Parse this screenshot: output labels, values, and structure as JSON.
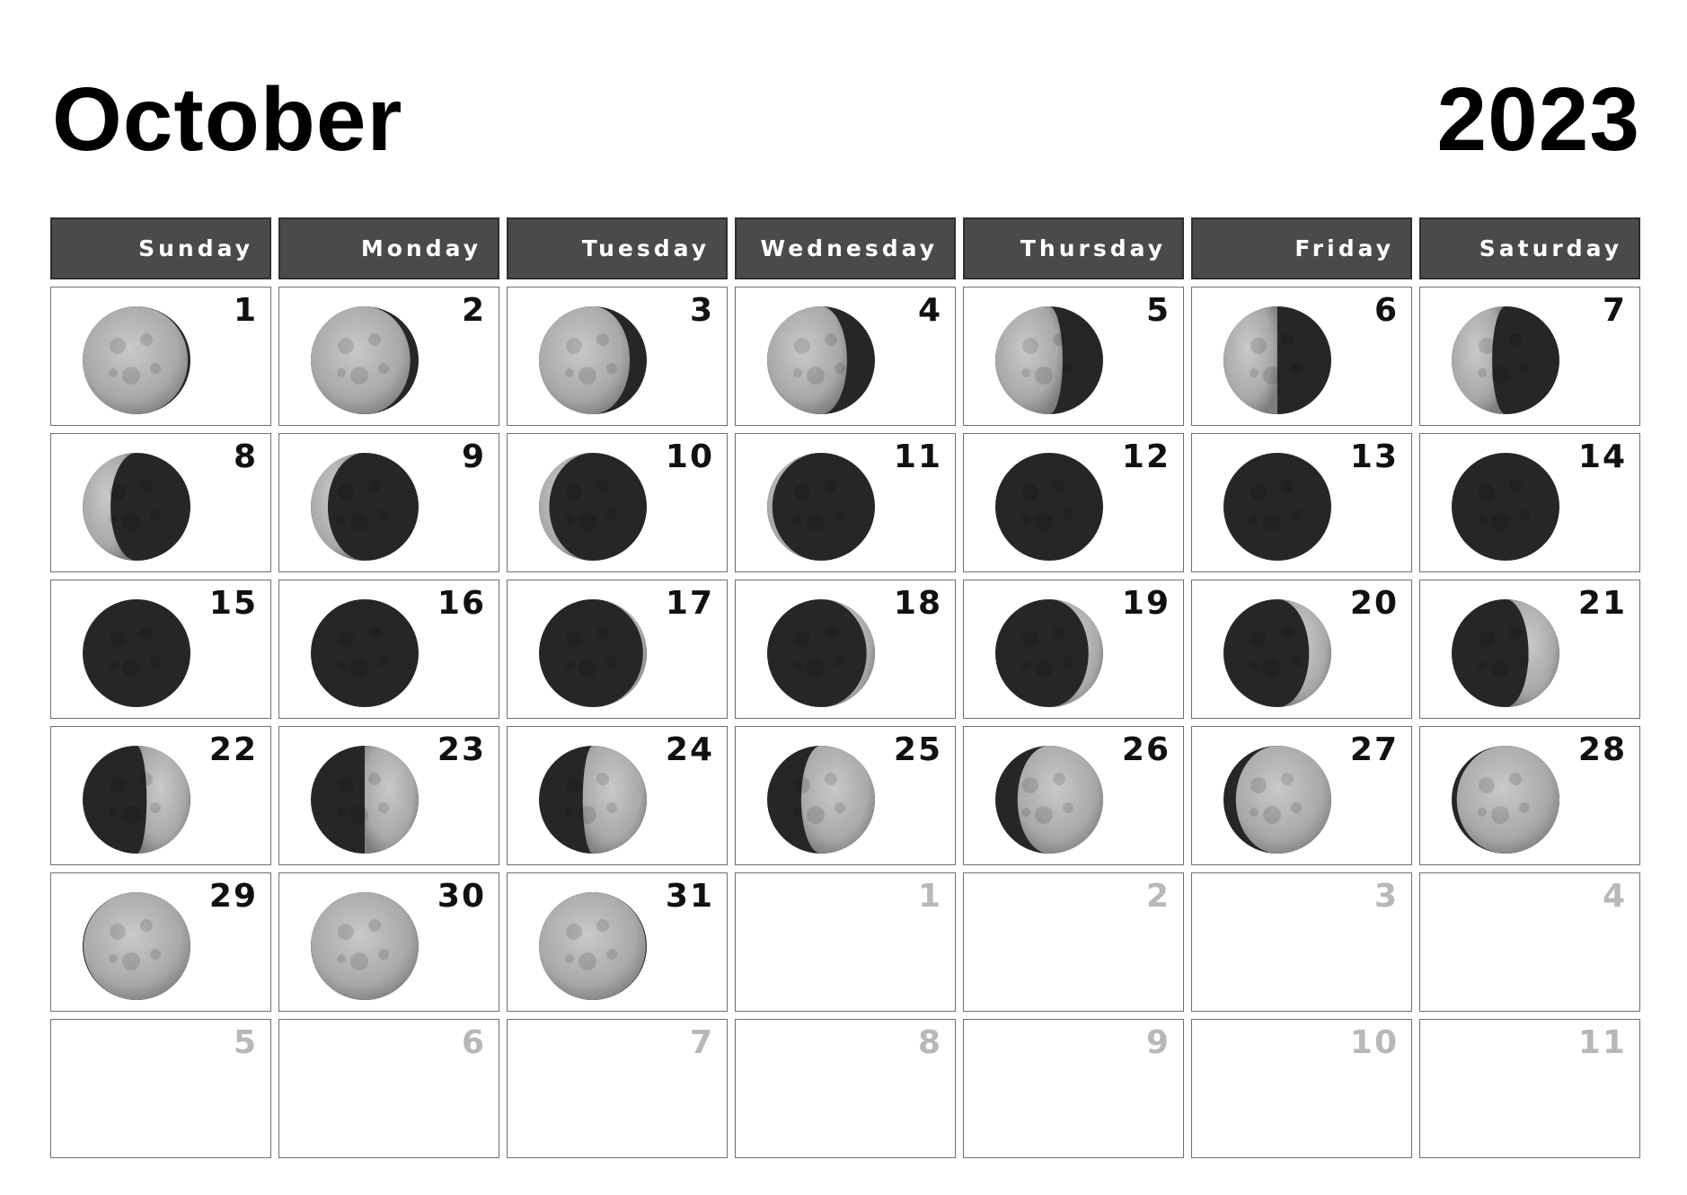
{
  "title": {
    "month": "October",
    "year": "2023"
  },
  "weekdays": [
    "Sunday",
    "Monday",
    "Tuesday",
    "Wednesday",
    "Thursday",
    "Friday",
    "Saturday"
  ],
  "days": [
    {
      "label": "1",
      "current": true,
      "phase": 0.05
    },
    {
      "label": "2",
      "current": true,
      "phase": 0.09
    },
    {
      "label": "3",
      "current": true,
      "phase": 0.13
    },
    {
      "label": "4",
      "current": true,
      "phase": 0.17
    },
    {
      "label": "5",
      "current": true,
      "phase": 0.21
    },
    {
      "label": "6",
      "current": true,
      "phase": 0.25
    },
    {
      "label": "7",
      "current": true,
      "phase": 0.29
    },
    {
      "label": "8",
      "current": true,
      "phase": 0.33
    },
    {
      "label": "9",
      "current": true,
      "phase": 0.37
    },
    {
      "label": "10",
      "current": true,
      "phase": 0.4
    },
    {
      "label": "11",
      "current": true,
      "phase": 0.43
    },
    {
      "label": "12",
      "current": true,
      "phase": 0.46
    },
    {
      "label": "13",
      "current": true,
      "phase": 0.48
    },
    {
      "label": "14",
      "current": true,
      "phase": 0.5
    },
    {
      "label": "15",
      "current": true,
      "phase": 0.51
    },
    {
      "label": "16",
      "current": true,
      "phase": 0.53
    },
    {
      "label": "17",
      "current": true,
      "phase": 0.56
    },
    {
      "label": "18",
      "current": true,
      "phase": 0.59
    },
    {
      "label": "19",
      "current": true,
      "phase": 0.62
    },
    {
      "label": "20",
      "current": true,
      "phase": 0.65
    },
    {
      "label": "21",
      "current": true,
      "phase": 0.68
    },
    {
      "label": "22",
      "current": true,
      "phase": 0.72
    },
    {
      "label": "23",
      "current": true,
      "phase": 0.75
    },
    {
      "label": "24",
      "current": true,
      "phase": 0.78
    },
    {
      "label": "25",
      "current": true,
      "phase": 0.81
    },
    {
      "label": "26",
      "current": true,
      "phase": 0.85
    },
    {
      "label": "27",
      "current": true,
      "phase": 0.89
    },
    {
      "label": "28",
      "current": true,
      "phase": 0.93
    },
    {
      "label": "29",
      "current": true,
      "phase": 0.97
    },
    {
      "label": "30",
      "current": true,
      "phase": 0.99
    },
    {
      "label": "31",
      "current": true,
      "phase": 0.03
    },
    {
      "label": "1",
      "current": false
    },
    {
      "label": "2",
      "current": false
    },
    {
      "label": "3",
      "current": false
    },
    {
      "label": "4",
      "current": false
    },
    {
      "label": "5",
      "current": false
    },
    {
      "label": "6",
      "current": false
    },
    {
      "label": "7",
      "current": false
    },
    {
      "label": "8",
      "current": false
    },
    {
      "label": "9",
      "current": false
    },
    {
      "label": "10",
      "current": false
    },
    {
      "label": "11",
      "current": false
    }
  ],
  "colors": {
    "header_bg": "#4a4a4a",
    "moon_lit": "#a9a9a9",
    "moon_dark": "#262626",
    "muted_number": "#b8b8b8"
  }
}
